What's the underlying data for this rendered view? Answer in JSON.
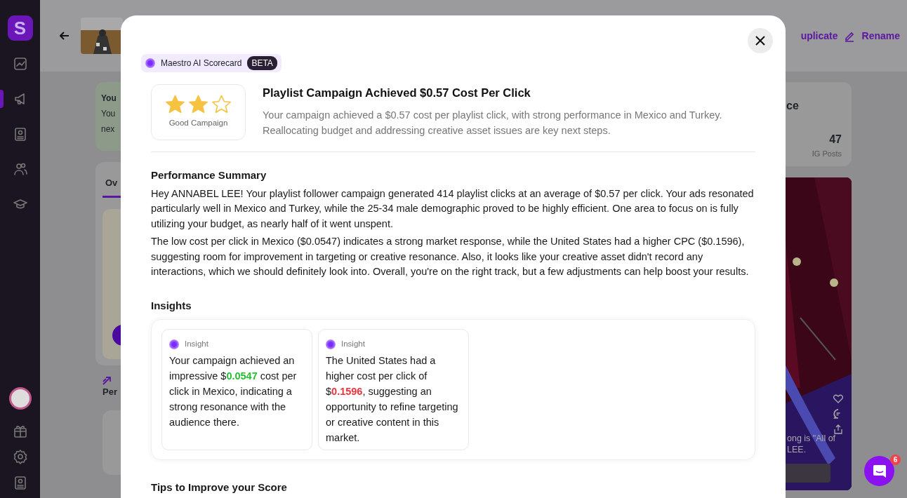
{
  "sidebar": {
    "logo": "S",
    "items": [
      {
        "kind": "chart",
        "selected": false
      },
      {
        "kind": "megaphone",
        "selected": true
      },
      {
        "kind": "contact",
        "selected": false
      },
      {
        "kind": "people",
        "selected": false
      },
      {
        "kind": "cap",
        "selected": false
      }
    ],
    "bottom_items": [
      {
        "kind": "avatar"
      },
      {
        "kind": "gift"
      },
      {
        "kind": "settings"
      },
      {
        "kind": "contact"
      }
    ]
  },
  "header": {
    "actions": [
      {
        "kind": "duplicate",
        "label": "uplicate"
      },
      {
        "kind": "rename",
        "label": "Rename"
      }
    ]
  },
  "background": {
    "banner_title": "You",
    "banner_lines": [
      "You",
      "nex"
    ],
    "tab": "Ov",
    "section_title": "Per",
    "stats_title": "ce",
    "stat_value": "47",
    "stat_label": "IG Posts",
    "caption_lines": [
      "ong is \"All of",
      "LEE."
    ]
  },
  "chat": {
    "badge": "6"
  },
  "modal": {
    "badge_label": "Maestro AI Scorecard",
    "badge_tag": "BETA",
    "rating": {
      "stars": 2,
      "label": "Good Campaign"
    },
    "title": "Playlist Campaign Achieved $0.57 Cost Per Click",
    "subtitle": "Your campaign achieved a $0.57 cost per playlist click, with strong performance in Mexico and Turkey. Reallocating budget and addressing creative asset issues are key next steps.",
    "summary_heading": "Performance Summary",
    "summary_paragraphs": [
      "Hey ANNABEL LEE! Your playlist follower campaign generated 414 playlist clicks at an average of $0.57 per click. Your ads resonated particularly well in Mexico and Turkey, while the 25-34 male demographic proved to be highly efficient. One area to focus on is fully utilizing your budget, as nearly half of it went unspent.",
      "The low cost per click in Mexico ($0.0547) indicates a strong market response, while the United States had a higher CPC ($0.1596), suggesting room for improvement in targeting or creative resonance. Also, it looks like your creative asset didn't record any interactions, which we should definitely look into. Overall, you're on the right track, but a few adjustments can help boost your results."
    ],
    "insights_heading": "Insights",
    "insights": [
      {
        "label": "Insight",
        "parts": [
          {
            "text": "Your campaign achieved an impressive $"
          },
          {
            "text": "0.0547",
            "color": "#22c02e"
          },
          {
            "text": " cost per click in Mexico, indicating a strong resonance with the audience there."
          }
        ]
      },
      {
        "label": "Insight",
        "parts": [
          {
            "text": "The United States had a higher cost per click of $"
          },
          {
            "text": "0.1596",
            "color": "#f0303a"
          },
          {
            "text": ", suggesting an opportunity to refine targeting or creative content in this market."
          }
        ]
      }
    ],
    "tips_heading": "Tips to Improve your Score"
  }
}
